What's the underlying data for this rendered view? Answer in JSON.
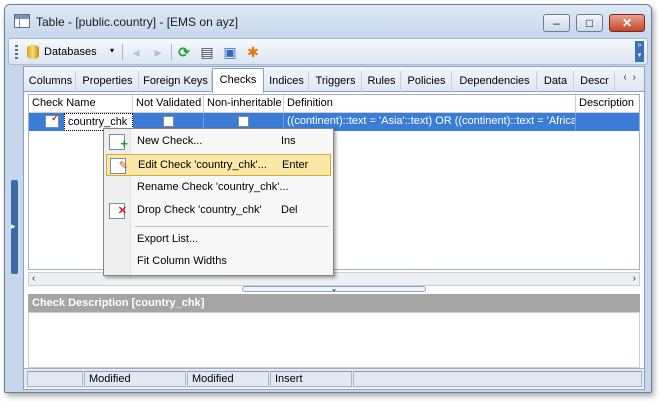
{
  "window": {
    "title": "Table - [public.country] - [EMS on ayz]",
    "controls": {
      "minimize": "–",
      "maximize": "□",
      "close": "✕"
    }
  },
  "toolbar": {
    "databases_label": "Databases",
    "dropdown_glyph": "▾",
    "icons": [
      "back-icon",
      "forward-icon",
      "refresh-icon",
      "print-icon",
      "properties-icon",
      "settings-icon"
    ]
  },
  "tabs": [
    {
      "label": "Columns"
    },
    {
      "label": "Properties"
    },
    {
      "label": "Foreign Keys"
    },
    {
      "label": "Checks",
      "active": true
    },
    {
      "label": "Indices"
    },
    {
      "label": "Triggers"
    },
    {
      "label": "Rules"
    },
    {
      "label": "Policies"
    },
    {
      "label": "Dependencies"
    },
    {
      "label": "Data"
    },
    {
      "label": "Descr"
    }
  ],
  "grid": {
    "columns": [
      "Check Name",
      "Not Validated",
      "Non-inheritable",
      "Definition",
      "Description"
    ],
    "rows": [
      {
        "check_name": "country_chk",
        "not_validated": false,
        "non_inheritable": false,
        "definition": "((continent)::text = 'Asia'::text) OR ((continent)::text = 'Africa'",
        "description": ""
      }
    ]
  },
  "context_menu": {
    "items": [
      {
        "label": "New Check...",
        "shortcut": "Ins",
        "icon": "new-check-icon"
      },
      {
        "label": "Edit Check 'country_chk'...",
        "shortcut": "Enter",
        "icon": "edit-check-icon",
        "highlighted": true
      },
      {
        "label": "Rename Check 'country_chk'...",
        "shortcut": ""
      },
      {
        "label": "Drop Check 'country_chk'",
        "shortcut": "Del",
        "icon": "drop-check-icon"
      },
      {
        "label": "Export List...",
        "shortcut": ""
      },
      {
        "label": "Fit Column Widths",
        "shortcut": ""
      }
    ]
  },
  "description_panel": {
    "header": "Check Description [country_chk]"
  },
  "statusbar": [
    "",
    "Modified",
    "Modified",
    "Insert"
  ]
}
